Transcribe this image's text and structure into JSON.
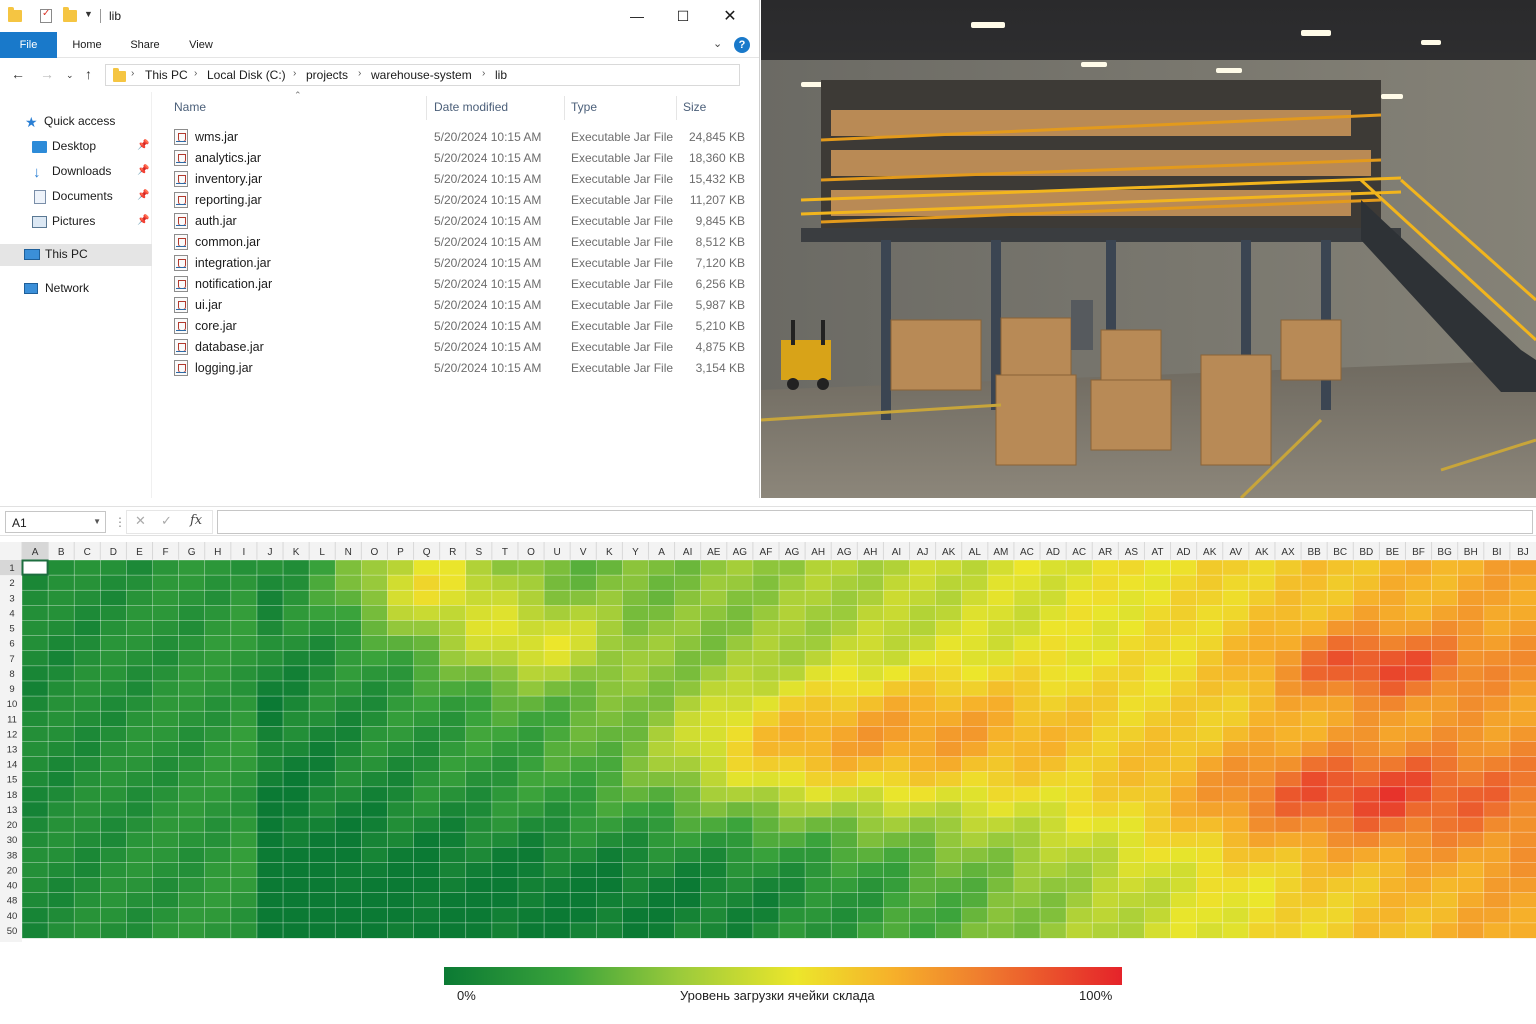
{
  "explorer": {
    "title": "lib",
    "ribbon_tabs": [
      "File",
      "Home",
      "Share",
      "View"
    ],
    "breadcrumb": [
      "This PC",
      "Local Disk (C:)",
      "projects",
      "warehouse-system",
      "lib"
    ],
    "nav": {
      "quick_access": "Quick access",
      "items": [
        "Desktop",
        "Downloads",
        "Documents",
        "Pictures"
      ],
      "this_pc": "This PC",
      "network": "Network"
    },
    "columns": {
      "name": "Name",
      "date": "Date modified",
      "type": "Type",
      "size": "Size"
    },
    "files": [
      {
        "name": "wms.jar",
        "date": "5/20/2024 10:15 AM",
        "type": "Executable Jar File",
        "size": "24,845 KB"
      },
      {
        "name": "analytics.jar",
        "date": "5/20/2024 10:15 AM",
        "type": "Executable Jar File",
        "size": "18,360 KB"
      },
      {
        "name": "inventory.jar",
        "date": "5/20/2024 10:15 AM",
        "type": "Executable Jar File",
        "size": "15,432 KB"
      },
      {
        "name": "reporting.jar",
        "date": "5/20/2024 10:15 AM",
        "type": "Executable Jar File",
        "size": "11,207 KB"
      },
      {
        "name": "auth.jar",
        "date": "5/20/2024 10:15 AM",
        "type": "Executable Jar File",
        "size": "9,845 KB"
      },
      {
        "name": "common.jar",
        "date": "5/20/2024 10:15 AM",
        "type": "Executable Jar File",
        "size": "8,512 KB"
      },
      {
        "name": "integration.jar",
        "date": "5/20/2024 10:15 AM",
        "type": "Executable Jar File",
        "size": "7,120 KB"
      },
      {
        "name": "notification.jar",
        "date": "5/20/2024 10:15 AM",
        "type": "Executable Jar File",
        "size": "6,256 KB"
      },
      {
        "name": "ui.jar",
        "date": "5/20/2024 10:15 AM",
        "type": "Executable Jar File",
        "size": "5,987 KB"
      },
      {
        "name": "core.jar",
        "date": "5/20/2024 10:15 AM",
        "type": "Executable Jar File",
        "size": "5,210 KB"
      },
      {
        "name": "database.jar",
        "date": "5/20/2024 10:15 AM",
        "type": "Executable Jar File",
        "size": "4,875 KB"
      },
      {
        "name": "logging.jar",
        "date": "5/20/2024 10:15 AM",
        "type": "Executable Jar File",
        "size": "3,154 KB"
      }
    ]
  },
  "spreadsheet": {
    "name_box": "A1",
    "fx_label": "fx",
    "column_headers": [
      "A",
      "B",
      "C",
      "D",
      "E",
      "F",
      "G",
      "H",
      "I",
      "J",
      "K",
      "L",
      "N",
      "O",
      "P",
      "Q",
      "R",
      "S",
      "T",
      "O",
      "U",
      "V",
      "K",
      "Y",
      "A",
      "AI",
      "AE",
      "AG",
      "AF",
      "AG",
      "AH",
      "AG",
      "AH",
      "AI",
      "AJ",
      "AK",
      "AL",
      "AM",
      "AC",
      "AD",
      "AC",
      "AR",
      "AS",
      "AT",
      "AD",
      "AK",
      "AV",
      "AK",
      "AX",
      "BB",
      "BC",
      "BD",
      "BE",
      "BF",
      "BG",
      "BH",
      "BI",
      "BJ"
    ],
    "row_headers": [
      "1",
      "2",
      "3",
      "4",
      "5",
      "6",
      "7",
      "8",
      "9",
      "10",
      "11",
      "12",
      "13",
      "14",
      "15",
      "18",
      "13",
      "20",
      "30",
      "38",
      "20",
      "40",
      "48",
      "40",
      "50"
    ]
  },
  "chart_data": {
    "type": "heatmap",
    "title": "",
    "colorbar": {
      "label": "Уровень загрузки ячейки склада",
      "min_label": "0%",
      "max_label": "100%"
    },
    "colors": [
      "#0b7a34",
      "#3aa33b",
      "#9ccb3b",
      "#ece62b",
      "#f6b12a",
      "#ef7a2e",
      "#e5232a"
    ],
    "rows": 25,
    "columns": 58,
    "description_of_pattern": "green on the left columns (A–J), hotspots near columns O–Q rows 1–4, S–U rows 5–8, AG–AK rows 10–14, BC–BE rows 6–8 and AX–BE rows 15–19"
  }
}
